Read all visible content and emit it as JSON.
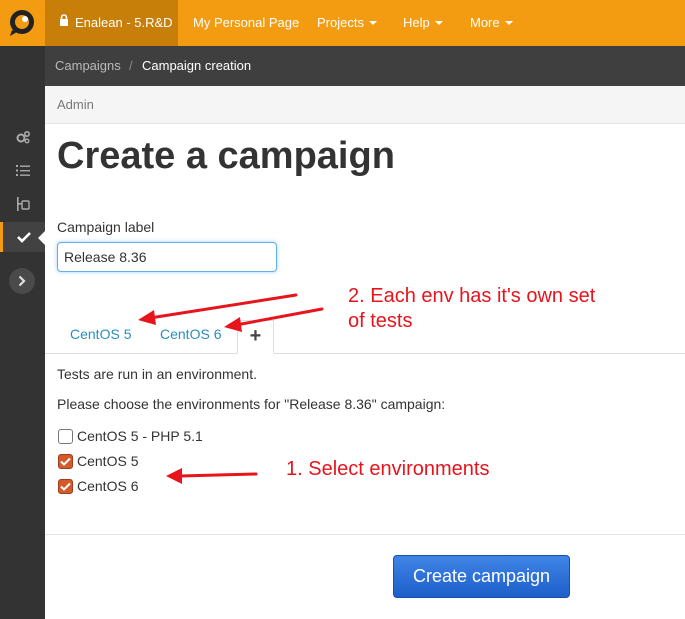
{
  "topnav": {
    "project": "Enalean - 5.R&D",
    "items": [
      {
        "label": "My Personal Page",
        "dropdown": false
      },
      {
        "label": "Projects",
        "dropdown": true
      },
      {
        "label": "Help",
        "dropdown": true
      },
      {
        "label": "More",
        "dropdown": true
      }
    ]
  },
  "sidebar": {
    "icons": [
      "gears-icon",
      "list-icon",
      "hierarchy-icon",
      "check-icon",
      "chevron-right-icon"
    ],
    "active": "check-icon"
  },
  "breadcrumb": {
    "parent": "Campaigns",
    "separator": "/",
    "current": "Campaign creation"
  },
  "admin": {
    "label": "Admin"
  },
  "page": {
    "title": "Create a campaign"
  },
  "form": {
    "label": "Campaign label",
    "value": "Release 8.36"
  },
  "tabs": {
    "items": [
      "CentOS 5",
      "CentOS 6"
    ],
    "add_label": "+"
  },
  "environments": {
    "intro": "Tests are run in an environment.",
    "prompt": "Please choose the environments for \"Release 8.36\" campaign:",
    "options": [
      {
        "label": "CentOS 5 - PHP 5.1",
        "checked": false
      },
      {
        "label": "CentOS 5",
        "checked": true
      },
      {
        "label": "CentOS 6",
        "checked": true
      }
    ]
  },
  "submit": {
    "label": "Create campaign"
  },
  "annotations": {
    "tabs_note_line1": "2. Each env has it's own set",
    "tabs_note_line2": "of tests",
    "select_note": "1. Select environments"
  },
  "colors": {
    "topbar": "#f39c12",
    "sidebar": "#333333",
    "accent_red": "#e8141c",
    "tab_link": "#2a8fbd",
    "button": "#1d5fcb"
  }
}
